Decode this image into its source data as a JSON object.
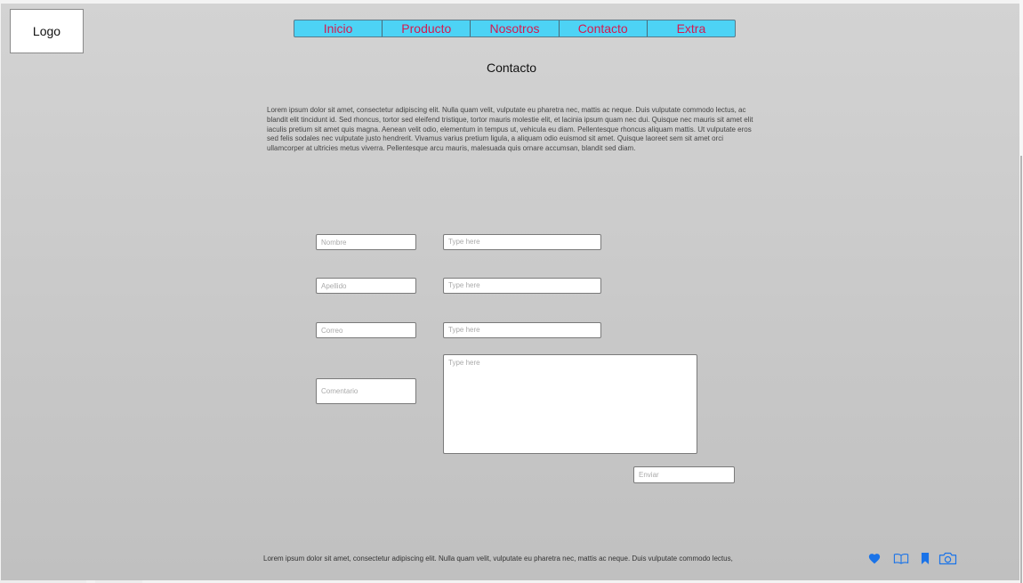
{
  "logo": {
    "label": "Logo"
  },
  "nav": {
    "items": [
      "Inicio",
      "Producto",
      "Nosotros",
      "Contacto",
      "Extra"
    ]
  },
  "page": {
    "title": "Contacto",
    "intro": "Lorem ipsum dolor sit amet, consectetur adipiscing elit. Nulla quam velit, vulputate eu pharetra nec, mattis ac neque. Duis vulputate commodo lectus, ac blandit elit tincidunt id. Sed rhoncus, tortor sed eleifend tristique, tortor mauris molestie elit, et lacinia ipsum quam nec dui. Quisque nec mauris sit amet elit iaculis pretium sit amet quis magna. Aenean velit odio, elementum in tempus ut, vehicula eu diam. Pellentesque rhoncus aliquam mattis. Ut vulputate eros sed felis sodales nec vulputate justo hendrerit. Vivamus varius pretium ligula, a aliquam odio euismod sit amet. Quisque laoreet sem sit amet orci ullamcorper at ultricies metus viverra. Pellentesque arcu mauris, malesuada quis ornare accumsan, blandit sed diam."
  },
  "form": {
    "fields": [
      {
        "label": "Nombre",
        "placeholder": "Type here"
      },
      {
        "label": "Apellido",
        "placeholder": "Type here"
      },
      {
        "label": "Correo",
        "placeholder": "Type here"
      },
      {
        "label": "Comentario",
        "placeholder": "Type here"
      }
    ],
    "submit": "Enviar"
  },
  "footer": {
    "text": "Lorem ipsum dolor sit amet, consectetur adipiscing elit. Nulla quam velit, vulputate eu pharetra nec, mattis ac neque. Duis vulputate commodo lectus,",
    "icons": [
      "heart-icon",
      "book-icon",
      "bookmark-icon",
      "camera-icon"
    ],
    "icon_color": "#1a73e8"
  },
  "colors": {
    "nav_background": "#4dd3f5",
    "nav_text": "#d61b4f"
  }
}
